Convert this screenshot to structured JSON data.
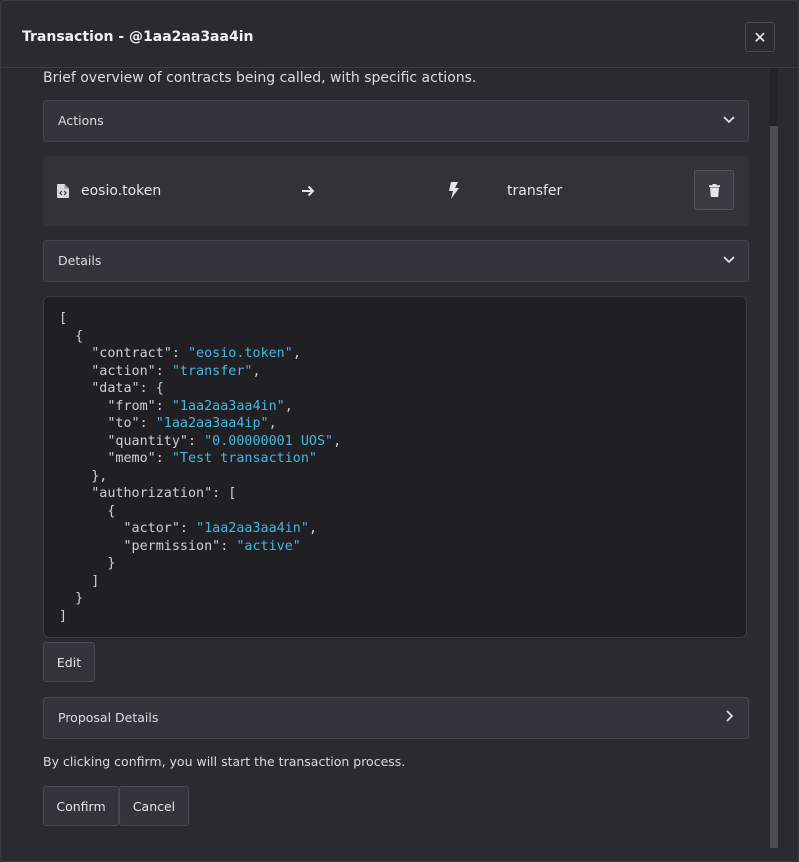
{
  "modal": {
    "title": "Transaction - @1aa2aa3aa4in",
    "close_label": "✕"
  },
  "intro": "Brief overview of contracts being called, with specific actions.",
  "actions_section": {
    "label": "Actions"
  },
  "action_row": {
    "contract": "eosio.token",
    "action": "transfer"
  },
  "details_section": {
    "label": "Details"
  },
  "json_lines": [
    "[",
    "  {",
    "    \"contract\": \"eosio.token\",",
    "    \"action\": \"transfer\",",
    "    \"data\": {",
    "      \"from\": \"1aa2aa3aa4in\",",
    "      \"to\": \"1aa2aa3aa4ip\",",
    "      \"quantity\": \"0.00000001 UOS\",",
    "      \"memo\": \"Test transaction\"",
    "    },",
    "    \"authorization\": [",
    "      {",
    "        \"actor\": \"1aa2aa3aa4in\",",
    "        \"permission\": \"active\"",
    "      }",
    "    ]",
    "  }",
    "]"
  ],
  "edit_label": "Edit",
  "proposal_section": {
    "label": "Proposal Details"
  },
  "notice": "By clicking confirm, you will start the transaction process.",
  "confirm_label": "Confirm",
  "cancel_label": "Cancel",
  "colors": {
    "string": "#45b8e0",
    "background": "#2a2a31",
    "code_bg": "#1f1f24"
  }
}
